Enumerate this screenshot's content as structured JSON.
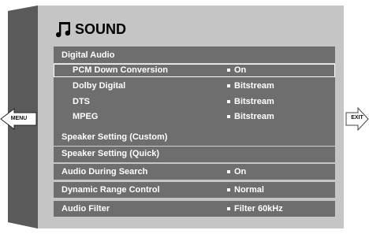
{
  "side": {
    "menu": "MENU",
    "exit": "EXIT"
  },
  "title": "SOUND",
  "groups": {
    "digital": {
      "header": "Digital Audio",
      "items": [
        {
          "label": "PCM Down Conversion",
          "value": "On"
        },
        {
          "label": "Dolby Digital",
          "value": "Bitstream"
        },
        {
          "label": "DTS",
          "value": "Bitstream"
        },
        {
          "label": "MPEG",
          "value": "Bitstream"
        }
      ]
    },
    "speaker": {
      "items": [
        {
          "label": "Speaker Setting (Custom)"
        },
        {
          "label": "Speaker Setting (Quick)"
        }
      ]
    },
    "search": {
      "label": "Audio  During Search",
      "value": "On"
    },
    "drc": {
      "label": "Dynamic Range Control",
      "value": "Normal"
    },
    "filter": {
      "label": "Audio  Filter",
      "value": "Filter 60kHz"
    }
  },
  "colors": {
    "panel": "#c5c5c5",
    "box": "#6e6e6e",
    "frame": "#6a6a6a"
  }
}
